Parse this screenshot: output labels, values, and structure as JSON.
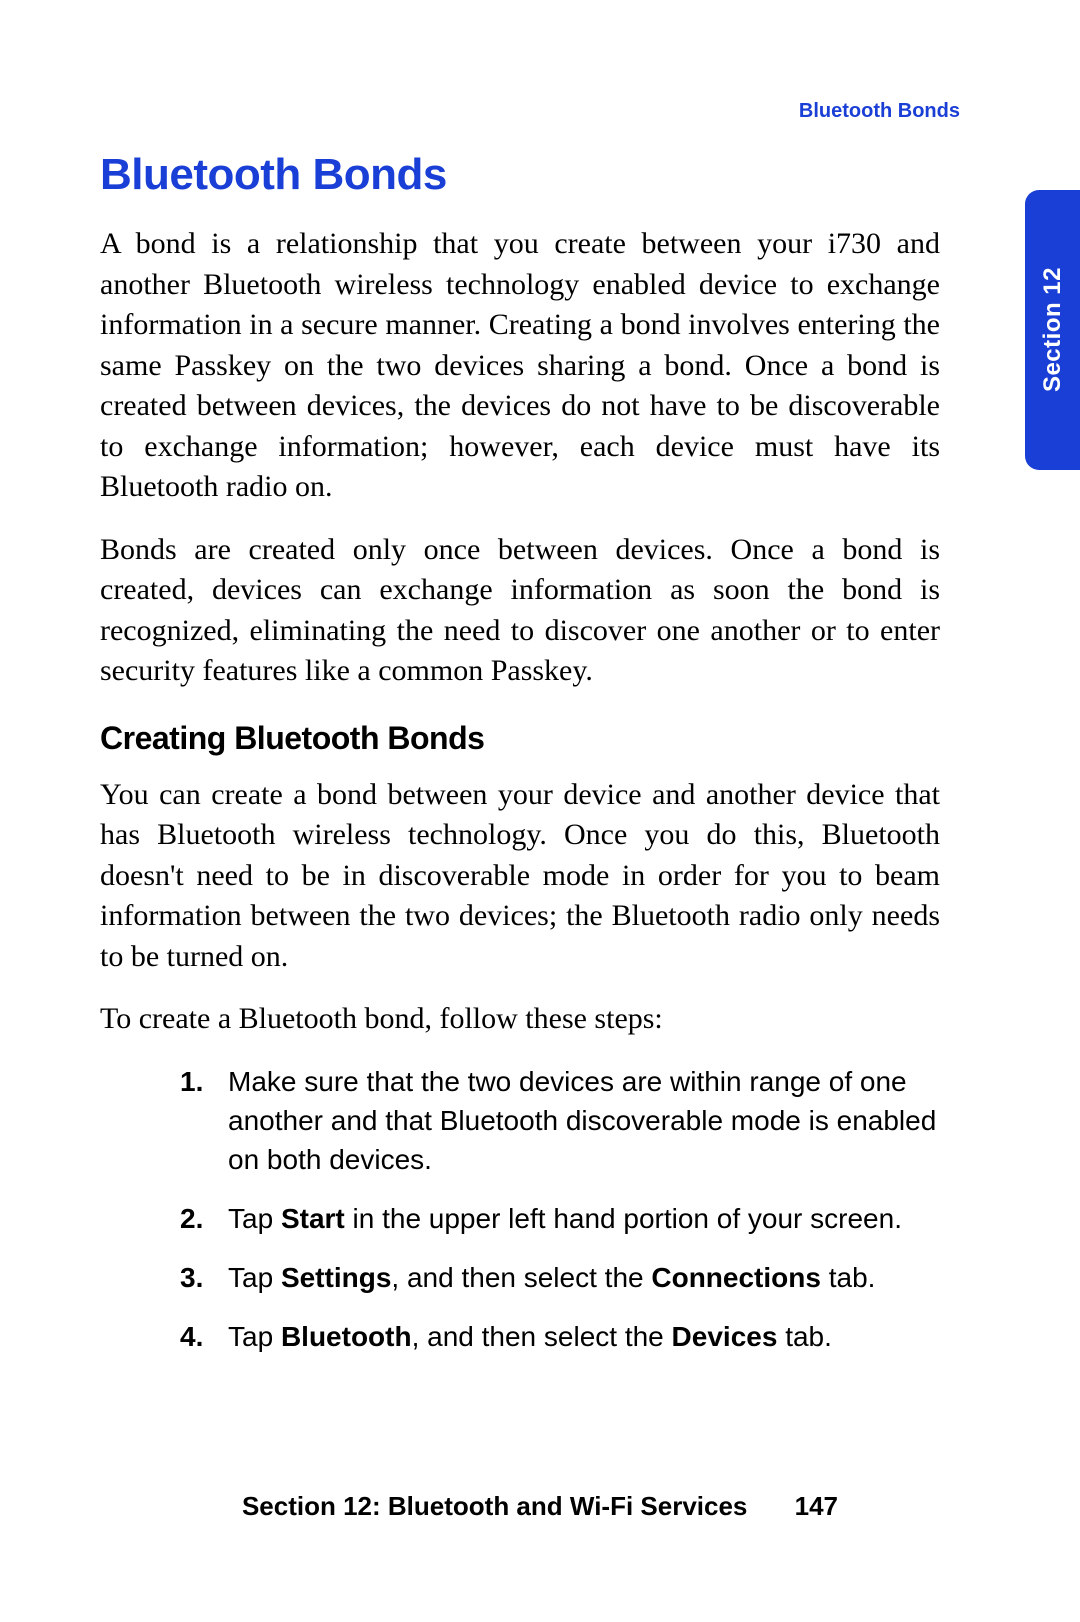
{
  "header": {
    "running_title": "Bluetooth Bonds"
  },
  "tab": {
    "label": "Section 12"
  },
  "main": {
    "heading": "Bluetooth Bonds",
    "p1": "A bond is a relationship that you create between your i730 and another Bluetooth wireless technology enabled device to exchange information in a secure manner. Creating a bond involves entering the same Passkey on the two devices sharing a bond. Once a bond is created between devices, the devices do not have to be discoverable to exchange information; however, each device must have its Bluetooth radio on.",
    "p2": "Bonds are created only once between devices. Once a bond is created, devices can exchange information as soon the bond is recognized, eliminating the need to discover one another or to enter security features like a common Passkey.",
    "subheading": "Creating Bluetooth Bonds",
    "p3": "You can create a bond between your device and another device that has Bluetooth wireless technology. Once you do this, Bluetooth doesn't need to be in discoverable mode in order for you to beam information between the two devices; the Bluetooth radio only needs to be turned on.",
    "p4": "To create a Bluetooth bond, follow these steps:",
    "steps": {
      "s1": "Make sure that the two devices are within range of one another and that Bluetooth discoverable mode is enabled on both devices.",
      "s2_pre": "Tap ",
      "s2_b1": "Start",
      "s2_post": " in the upper left hand portion of your screen.",
      "s3_pre": "Tap ",
      "s3_b1": "Settings",
      "s3_mid": ", and then select the ",
      "s3_b2": "Connections",
      "s3_post": " tab.",
      "s4_pre": "Tap ",
      "s4_b1": "Bluetooth",
      "s4_mid": ", and then select the ",
      "s4_b2": "Devices",
      "s4_post": " tab."
    }
  },
  "footer": {
    "section_label": "Section 12: Bluetooth and Wi-Fi Services",
    "page_number": "147"
  }
}
